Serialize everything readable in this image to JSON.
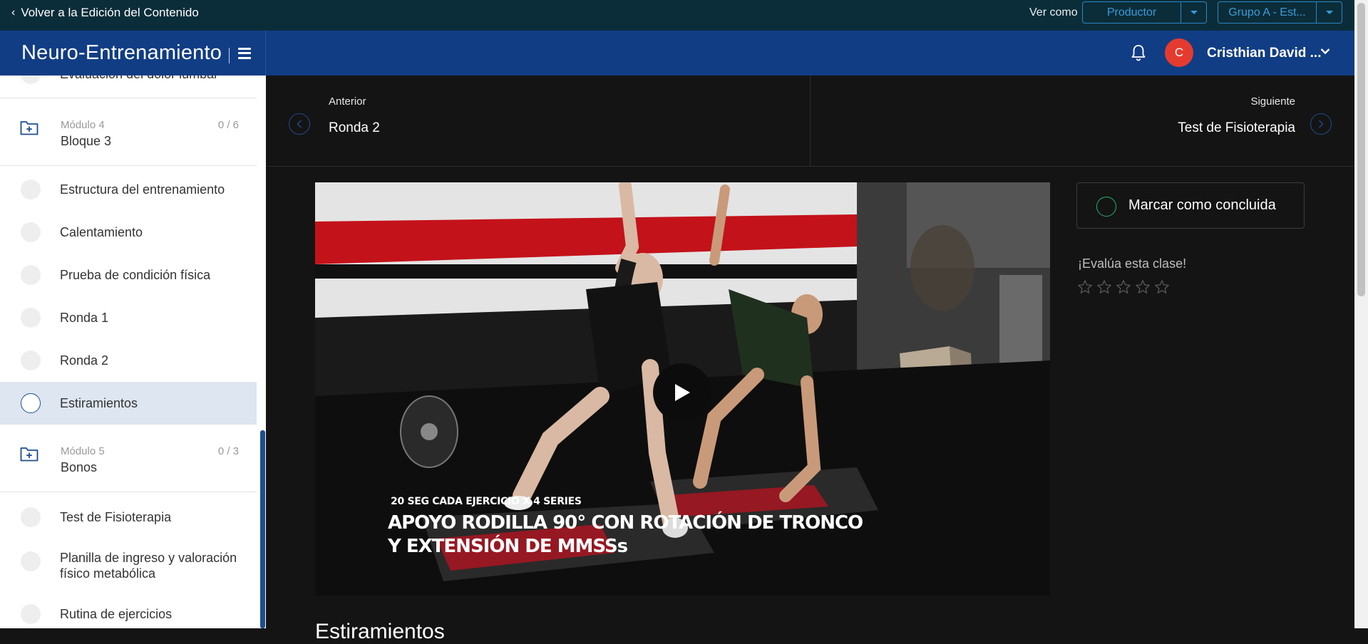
{
  "topbar": {
    "back_label": "Volver a la Edición del Contenido",
    "view_as_label": "Ver como",
    "role_select": "Productor",
    "group_select": "Grupo A - Est..."
  },
  "header": {
    "brand": "Neuro-Entrenamiento",
    "avatar_initial": "C",
    "user_name": "Cristhian David ..."
  },
  "sidebar": {
    "items": [
      {
        "kind": "lesson",
        "title": "Evaluación del dolor lumbar"
      },
      {
        "kind": "module",
        "label": "Módulo 4",
        "title": "Bloque 3",
        "count": "0 / 6"
      },
      {
        "kind": "lesson",
        "title": "Estructura del entrenamiento"
      },
      {
        "kind": "lesson",
        "title": "Calentamiento"
      },
      {
        "kind": "lesson",
        "title": "Prueba de condición física"
      },
      {
        "kind": "lesson",
        "title": "Ronda 1"
      },
      {
        "kind": "lesson",
        "title": "Ronda 2"
      },
      {
        "kind": "lesson",
        "title": "Estiramientos",
        "active": true
      },
      {
        "kind": "module",
        "label": "Módulo 5",
        "title": "Bonos",
        "count": "0 / 3"
      },
      {
        "kind": "lesson",
        "title": "Test de Fisioterapia"
      },
      {
        "kind": "lesson",
        "title": "Planilla de ingreso y valoración físico metabólica"
      },
      {
        "kind": "lesson",
        "title": "Rutina de ejercicios"
      }
    ]
  },
  "nav": {
    "prev_label": "Anterior",
    "prev_title": "Ronda 2",
    "next_label": "Siguiente",
    "next_title": "Test de Fisioterapia"
  },
  "video": {
    "caption_small": "20 SEG CADA EJERCICIO X 4 SERIES",
    "caption_line1": "APOYO RODILLA 90° CON ROTACIÓN DE TRONCO",
    "caption_line2": "Y EXTENSIÓN DE MMSSs"
  },
  "aside": {
    "mark_complete": "Marcar como concluida",
    "rate_label": "¡Evalúa esta clase!",
    "stars_total": 5,
    "stars_filled": 0
  },
  "content": {
    "title": "Estiramientos"
  },
  "colors": {
    "topbar": "#0b2d3a",
    "header": "#113d85",
    "accent": "#2b86c2",
    "avatar": "#e53b2f",
    "complete_ring": "#24b36b"
  }
}
